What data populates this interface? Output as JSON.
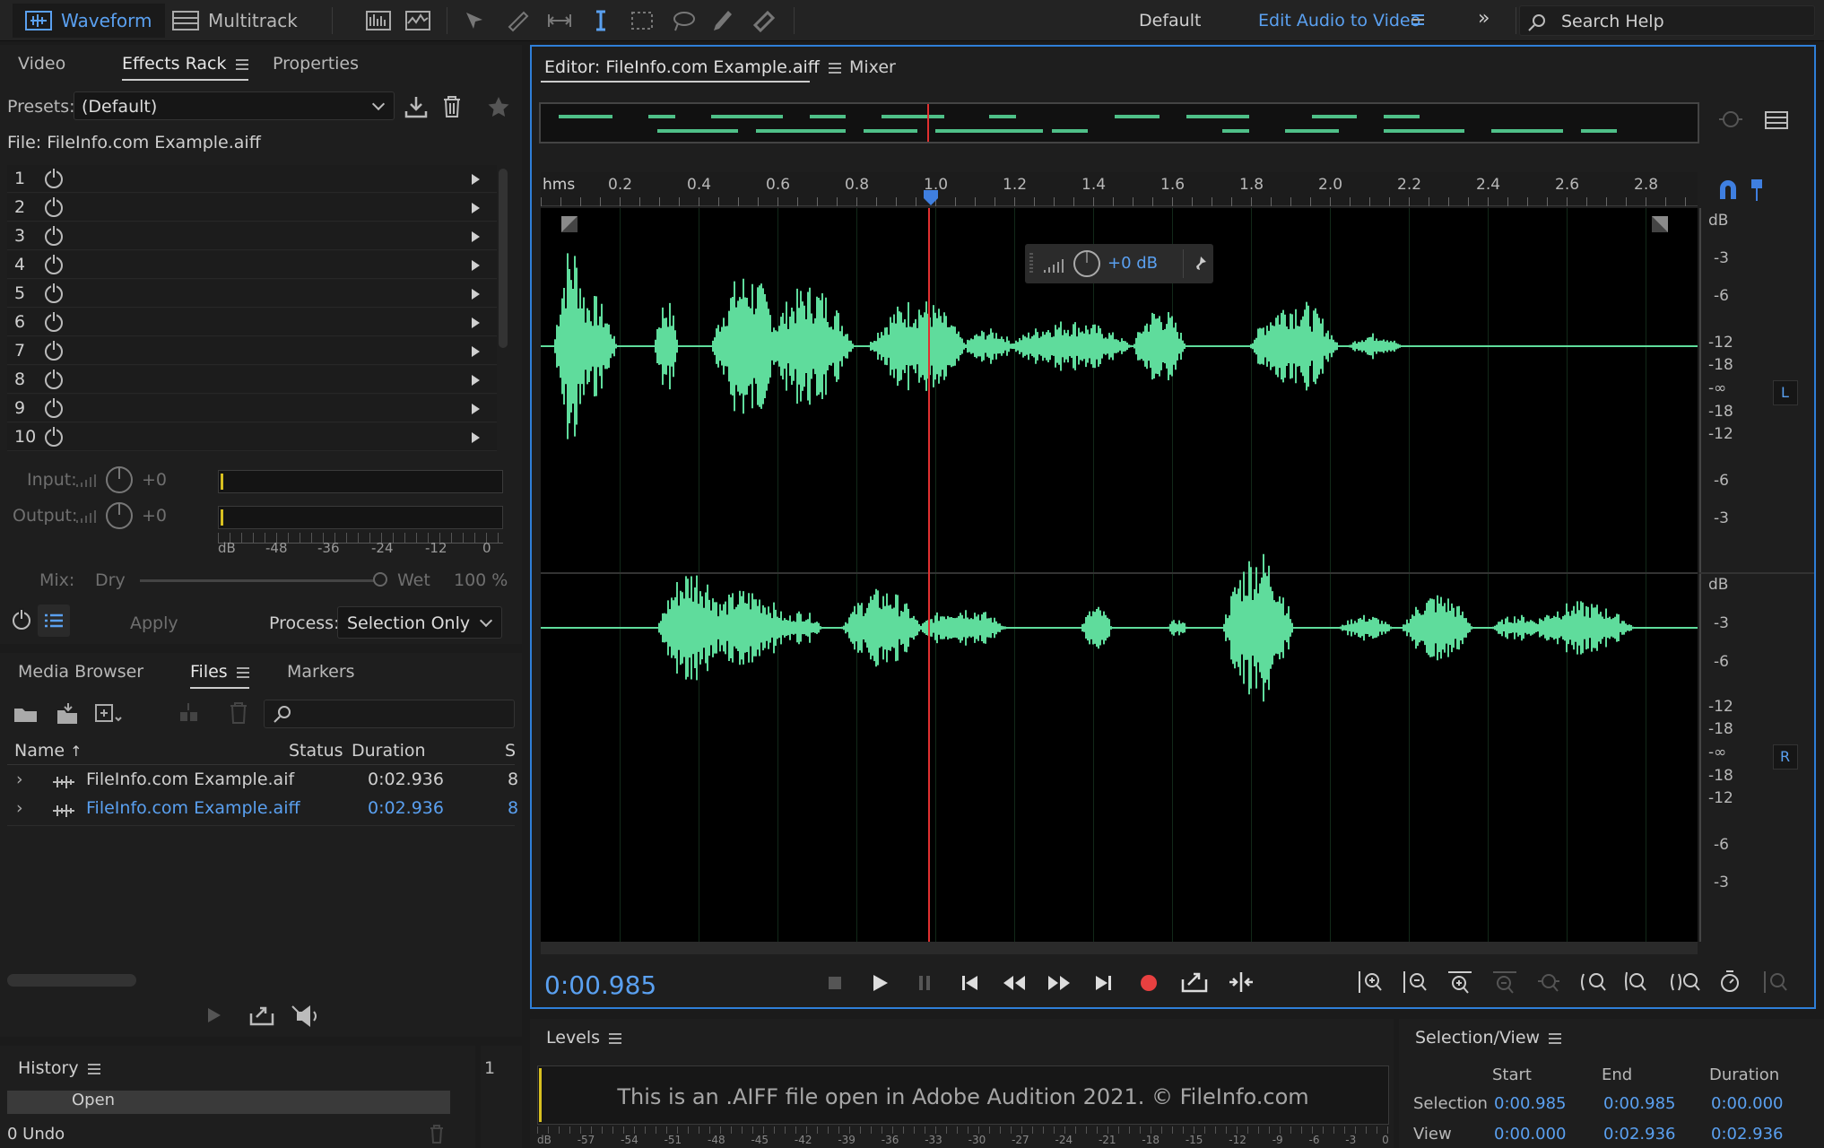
{
  "topbar": {
    "waveform": "Waveform",
    "multitrack": "Multitrack",
    "workspace_default": "Default",
    "workspace_active": "Edit Audio to Video",
    "search": "Search Help"
  },
  "left_tabs": {
    "video": "Video",
    "effects_rack": "Effects Rack",
    "properties": "Properties"
  },
  "effects_rack": {
    "presets_label": "Presets:",
    "presets_value": "(Default)",
    "file_label": "File: FileInfo.com Example.aiff",
    "slots": [
      "1",
      "2",
      "3",
      "4",
      "5",
      "6",
      "7",
      "8",
      "9",
      "10"
    ],
    "input_label": "Input:",
    "input_value": "+0",
    "output_label": "Output:",
    "output_value": "+0",
    "scale": [
      "dB",
      "-48",
      "-36",
      "-24",
      "-12",
      "0"
    ],
    "mix_label": "Mix:",
    "dry": "Dry",
    "wet": "Wet",
    "wet_pct": "100 %",
    "apply": "Apply",
    "process_label": "Process:",
    "process_value": "Selection Only"
  },
  "files_tabs": {
    "media_browser": "Media Browser",
    "files": "Files",
    "markers": "Markers"
  },
  "files": {
    "columns": {
      "name": "Name",
      "status": "Status",
      "duration": "Duration",
      "s": "S"
    },
    "rows": [
      {
        "name": "FileInfo.com Example.aif",
        "duration": "0:02.936",
        "s": "8"
      },
      {
        "name": "FileInfo.com Example.aiff",
        "duration": "0:02.936",
        "s": "8"
      }
    ]
  },
  "history": {
    "title": "History",
    "item": "Open",
    "undo": "0 Undo",
    "side": "1"
  },
  "editor": {
    "tab_editor": "Editor: FileInfo.com Example.aiff",
    "tab_mixer": "Mixer",
    "ruler_unit": "hms",
    "ruler_ticks": [
      "0.2",
      "0.4",
      "0.6",
      "0.8",
      "1.0",
      "1.2",
      "1.4",
      "1.6",
      "1.8",
      "2.0",
      "2.2",
      "2.4",
      "2.6",
      "2.8"
    ],
    "gain": "+0 dB",
    "db_labels_top": [
      "dB",
      "-3",
      "-6",
      "-12",
      "-18",
      "-∞",
      "-18",
      "-12",
      "-6",
      "-3"
    ],
    "db_labels_bottom": [
      "dB",
      "-3",
      "-6",
      "-12",
      "-18",
      "-∞",
      "-18",
      "-12",
      "-6",
      "-3"
    ],
    "channel_l": "L",
    "channel_r": "R",
    "timecode": "0:00.985"
  },
  "levels": {
    "title": "Levels",
    "caption": "This is an .AIFF file open in Adobe Audition 2021. © FileInfo.com",
    "scale": [
      "dB",
      "-57",
      "-54",
      "-51",
      "-48",
      "-45",
      "-42",
      "-39",
      "-36",
      "-33",
      "-30",
      "-27",
      "-24",
      "-21",
      "-18",
      "-15",
      "-12",
      "-9",
      "-6",
      "-3",
      "0"
    ]
  },
  "selection_view": {
    "title": "Selection/View",
    "headers": {
      "start": "Start",
      "end": "End",
      "duration": "Duration"
    },
    "selection": {
      "label": "Selection",
      "start": "0:00.985",
      "end": "0:00.985",
      "duration": "0:00.000"
    },
    "view": {
      "label": "View",
      "start": "0:00.000",
      "end": "0:02.936",
      "duration": "0:02.936"
    }
  },
  "colors": {
    "accent": "#5aa0f0",
    "wave": "#5fdc9c",
    "playhead": "#e03030",
    "record": "#e84040"
  }
}
